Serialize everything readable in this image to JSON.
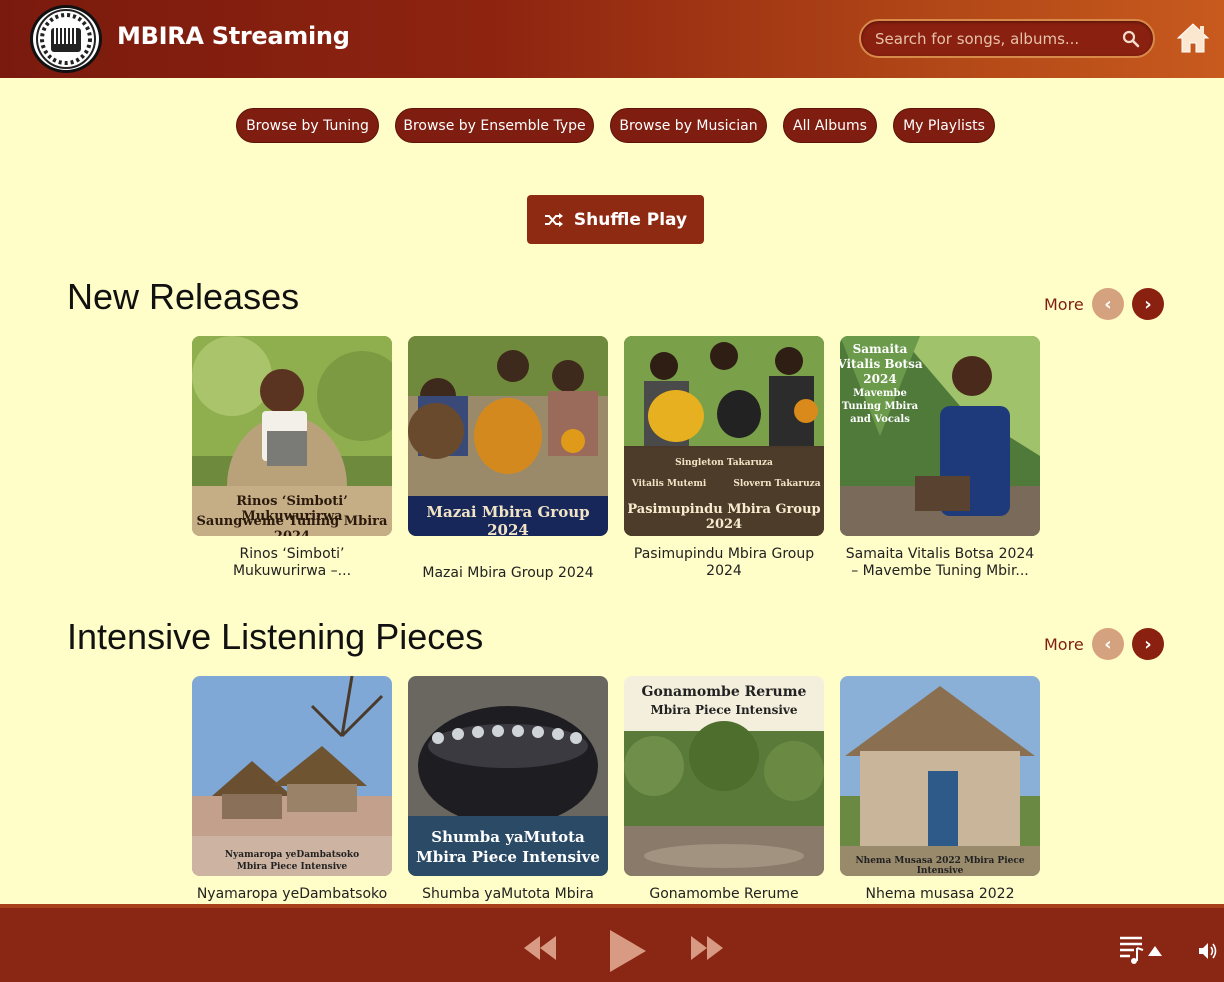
{
  "app": {
    "title": "MBIRA Streaming"
  },
  "search": {
    "placeholder": "Search for songs, albums..."
  },
  "nav": {
    "items": [
      "Browse by Tuning",
      "Browse by Ensemble Type",
      "Browse by Musician",
      "All Albums",
      "My Playlists"
    ]
  },
  "shuffle_label": "Shuffle Play",
  "sections": [
    {
      "title": "New Releases",
      "more_label": "More",
      "albums": [
        {
          "cover_text": [
            "Rinos ‘Simboti’ Mukuwurirwa",
            "Saungweme Tuning Mbira 2024"
          ],
          "caption": [
            "Rinos ‘Simboti’",
            "Mukuwurirwa –..."
          ]
        },
        {
          "cover_text": [
            "Mazai Mbira Group 2024"
          ],
          "caption": [
            "Mazai Mbira Group 2024"
          ]
        },
        {
          "cover_text": [
            "Singleton Takaruza",
            "Vitalis Mutemi",
            "Slovern Takaruza",
            "Pasimupindu Mbira Group 2024"
          ],
          "caption": [
            "Pasimupindu Mbira Group",
            "2024"
          ]
        },
        {
          "cover_text": [
            "Samaita",
            "Vitalis Botsa",
            "2024",
            "Mavembe",
            "Tuning Mbira",
            "and Vocals"
          ],
          "caption": [
            "Samaita Vitalis Botsa 2024",
            "– Mavembe Tuning Mbir..."
          ]
        }
      ]
    },
    {
      "title": "Intensive Listening Pieces",
      "more_label": "More",
      "albums": [
        {
          "cover_text": [
            "Nyamaropa yeDambatsoko",
            "Mbira Piece Intensive"
          ],
          "caption": [
            "Nyamaropa yeDambatsoko"
          ]
        },
        {
          "cover_text": [
            "Shumba yaMutota",
            "Mbira Piece Intensive"
          ],
          "caption": [
            "Shumba yaMutota Mbira"
          ]
        },
        {
          "cover_text": [
            "Gonamombe Rerume",
            "Mbira Piece Intensive"
          ],
          "caption": [
            "Gonamombe Rerume"
          ]
        },
        {
          "cover_text": [
            "Nhema Musasa 2022 Mbira Piece Intensive"
          ],
          "caption": [
            "Nhema musasa 2022"
          ]
        }
      ]
    }
  ],
  "colors": {
    "header": "#8e2410",
    "accent": "#7e1d10",
    "background": "#fffdc8",
    "player": "#8a2614"
  }
}
